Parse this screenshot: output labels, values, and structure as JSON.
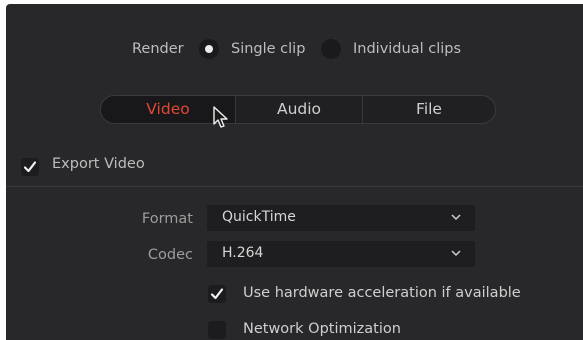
{
  "render": {
    "label": "Render",
    "options": [
      {
        "label": "Single clip",
        "selected": true
      },
      {
        "label": "Individual clips",
        "selected": false
      }
    ]
  },
  "tabs": [
    {
      "label": "Video",
      "active": true
    },
    {
      "label": "Audio",
      "active": false
    },
    {
      "label": "File",
      "active": false
    }
  ],
  "export_video": {
    "label": "Export Video",
    "checked": true
  },
  "format": {
    "label": "Format",
    "value": "QuickTime"
  },
  "codec": {
    "label": "Codec",
    "value": "H.264"
  },
  "options": [
    {
      "label": "Use hardware acceleration if available",
      "checked": true
    },
    {
      "label": "Network Optimization",
      "checked": false
    }
  ],
  "colors": {
    "panel_bg": "#28282b",
    "active_tab": "#e04832"
  }
}
